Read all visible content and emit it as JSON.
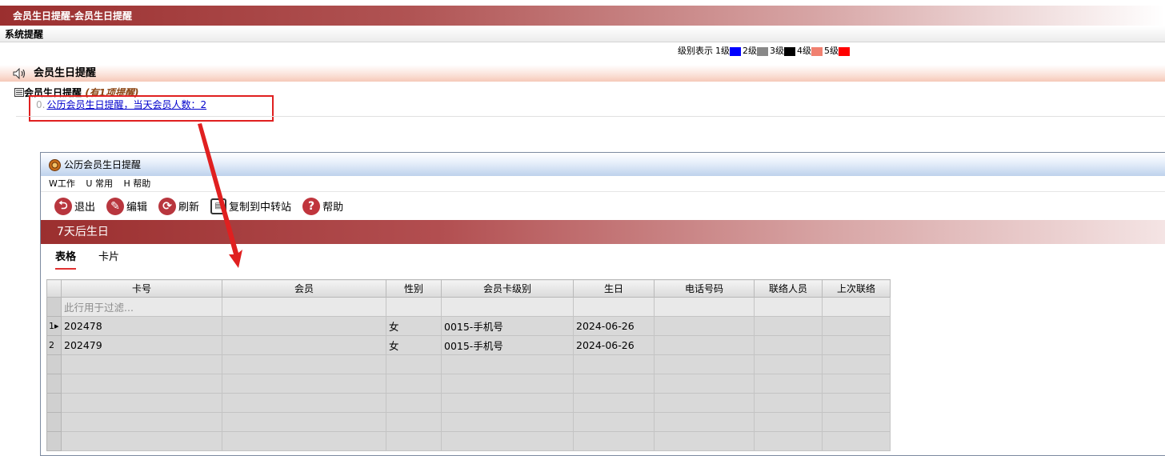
{
  "window": {
    "title": "会员生日提醒-会员生日提醒"
  },
  "menu": {
    "system_reminder": "系统提醒"
  },
  "legend": {
    "label": "级别表示",
    "levels": [
      {
        "label": "1级",
        "color": "#0000ff"
      },
      {
        "label": "2级",
        "color": "#888888"
      },
      {
        "label": "3级",
        "color": "#000000"
      },
      {
        "label": "4级",
        "color": "#f08070"
      },
      {
        "label": "5级",
        "color": "#ff0000"
      }
    ]
  },
  "section": {
    "title": "会员生日提醒",
    "icon": "speaker-icon"
  },
  "tree": {
    "root_label": "会员生日提醒",
    "root_note": "(有1项提醒)",
    "item_num": "0.",
    "item_link": "公历会员生日提醒，当天会员人数：2"
  },
  "dialog": {
    "title": "公历会员生日提醒",
    "menu": [
      "W工作",
      "U 常用",
      "H 帮助"
    ],
    "toolbar": [
      {
        "label": "退出",
        "icon": "exit-icon"
      },
      {
        "label": "编辑",
        "icon": "edit-icon"
      },
      {
        "label": "刷新",
        "icon": "refresh-icon"
      },
      {
        "label": "复制到中转站",
        "icon": "save-icon"
      },
      {
        "label": "帮助",
        "icon": "help-icon"
      }
    ],
    "banner": "7天后生日",
    "tabs": [
      "表格",
      "卡片"
    ],
    "table": {
      "headers": [
        "卡号",
        "会员",
        "性别",
        "会员卡级别",
        "生日",
        "电话号码",
        "联络人员",
        "上次联络"
      ],
      "filter_placeholder": "此行用于过滤...",
      "rows": [
        {
          "indicator": "1▸",
          "cells": [
            "202478",
            "",
            "女",
            "0015-手机号",
            "2024-06-26",
            "",
            "",
            ""
          ]
        },
        {
          "indicator": "2",
          "cells": [
            "202479",
            "",
            "女",
            "0015-手机号",
            "2024-06-26",
            "",
            "",
            ""
          ]
        }
      ]
    }
  },
  "annotation": {
    "box_color": "#e02020",
    "arrow_color": "#e02020"
  }
}
